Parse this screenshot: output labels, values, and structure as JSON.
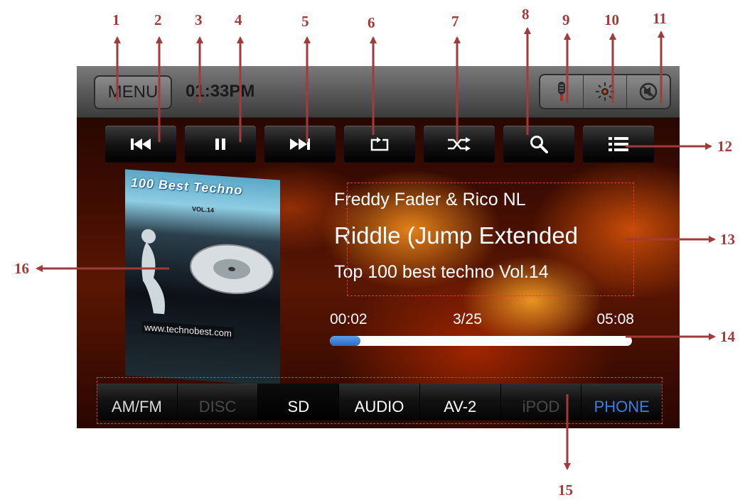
{
  "callouts": [
    "1",
    "2",
    "3",
    "4",
    "5",
    "6",
    "7",
    "8",
    "9",
    "10",
    "11",
    "12",
    "13",
    "14",
    "15",
    "16"
  ],
  "topbar": {
    "menu_label": "MENU",
    "clock": "01:33PM",
    "icons": [
      "microphone-icon",
      "brightness-icon",
      "mute-icon"
    ]
  },
  "controls": {
    "icons": [
      "previous-icon",
      "pause-icon",
      "next-icon",
      "repeat-icon",
      "shuffle-icon",
      "search-icon",
      "list-icon"
    ]
  },
  "album_art": {
    "title": "100 Best Techno",
    "volume": "VOL.14",
    "url": "www.technobest.com"
  },
  "track": {
    "artist": "Freddy Fader & Rico NL",
    "title": "Riddle (Jump Extended",
    "album": "Top 100 best techno Vol.14"
  },
  "playback": {
    "elapsed": "00:02",
    "track_counter": "3/25",
    "total": "05:08",
    "progress": 0.1
  },
  "sources": [
    {
      "label": "AM/FM",
      "state": "available",
      "color": "#d8d8d8"
    },
    {
      "label": "DISC",
      "state": "disabled",
      "color": "#4a4a4a"
    },
    {
      "label": "SD",
      "state": "active",
      "color": "#ffffff"
    },
    {
      "label": "AUDIO",
      "state": "available",
      "color": "#ffffff"
    },
    {
      "label": "AV-2",
      "state": "available",
      "color": "#ffffff"
    },
    {
      "label": "iPOD",
      "state": "disabled",
      "color": "#4a4a4a"
    },
    {
      "label": "PHONE",
      "state": "available",
      "color": "#3f7de0"
    }
  ],
  "colors": {
    "callout": "#a23a3a",
    "progress_fill": "#3a7ad6"
  }
}
